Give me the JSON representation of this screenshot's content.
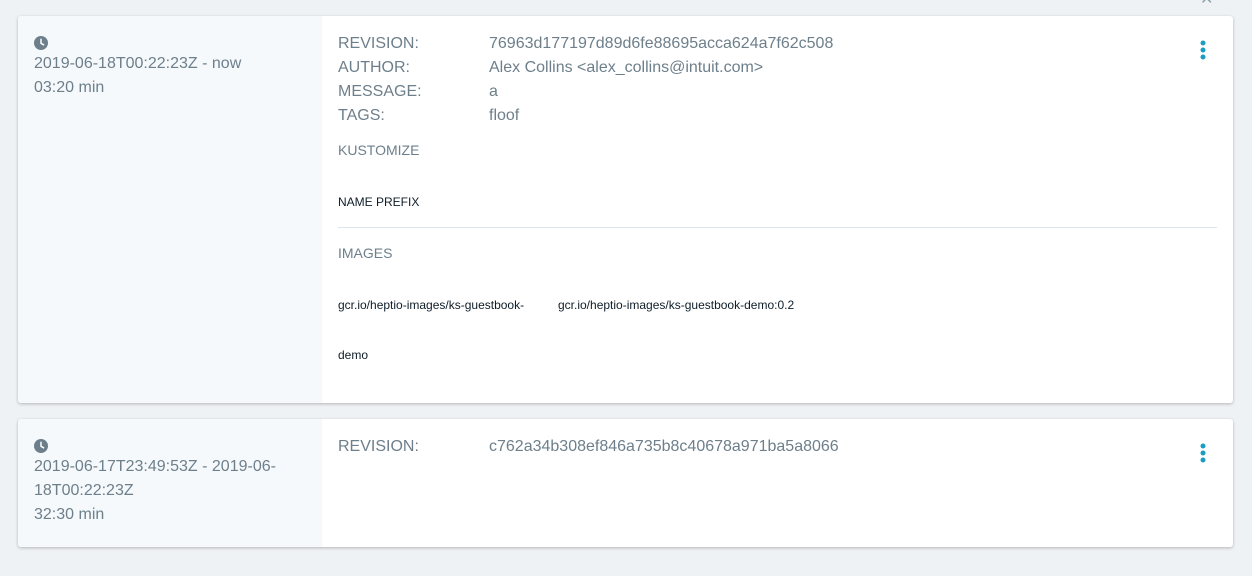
{
  "icons": {
    "clock": "clock-icon",
    "menu": "vertical-ellipsis-icon",
    "close": "close-icon"
  },
  "colors": {
    "accent": "#1a9cc3",
    "text": "#6d7f8b",
    "dark": "#0e1d29",
    "panel": "#f5f9fc"
  },
  "history": [
    {
      "date_range": "2019-06-18T00:22:23Z - now",
      "duration": "03:20 min",
      "revision_label": "REVISION:",
      "revision": "76963d177197d89d6fe88695acca624a7f62c508",
      "author_label": "AUTHOR:",
      "author": "Alex Collins <alex_collins@intuit.com>",
      "message_label": "MESSAGE:",
      "message": "a",
      "tags_label": "TAGS:",
      "tags": "floof",
      "kustomize_title": "KUSTOMIZE",
      "name_prefix_label": "NAME PREFIX",
      "images_title": "IMAGES",
      "image_name_line1": "gcr.io/heptio-images/ks-guestbook-",
      "image_name_line2": "demo",
      "image_value": "gcr.io/heptio-images/ks-guestbook-demo:0.2"
    },
    {
      "date_range_line1": "2019-06-17T23:49:53Z - 2019-06-",
      "date_range_line2": "18T00:22:23Z",
      "duration": "32:30 min",
      "revision_label": "REVISION:",
      "revision": "c762a34b308ef846a735b8c40678a971ba5a8066"
    }
  ]
}
